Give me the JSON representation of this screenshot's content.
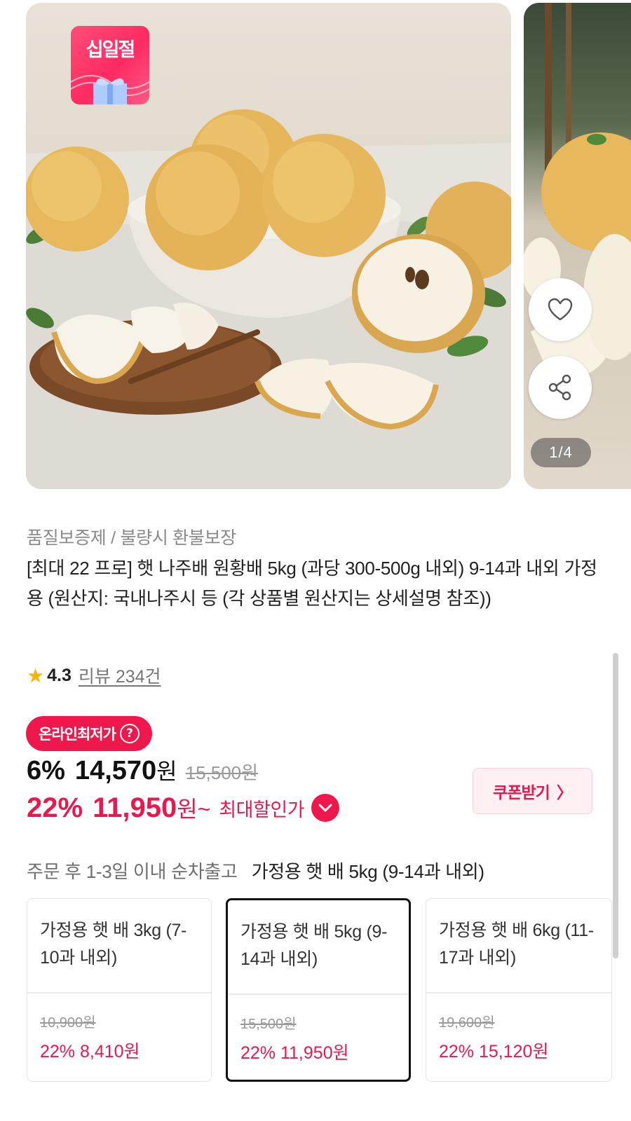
{
  "gallery": {
    "badge_text": "십일절",
    "pager": "1/4",
    "like_icon": "heart-icon",
    "share_icon": "share-icon"
  },
  "product": {
    "guarantee": "품질보증제 / 불량시 환불보장",
    "title": "[최대 22 프로] 햇 나주배 원황배 5kg (과당 300-500g 내외) 9-14과 내외 가정용 (원산지: 국내나주시 등 (각 상품별 원산지는 상세설명 참조))",
    "rating": "4.3",
    "reviews": "리뷰 234건"
  },
  "price": {
    "lowest_badge": "온라인최저가",
    "help_icon": "?",
    "discount1": "6%",
    "price1": "14,570",
    "won1": "원",
    "original": "15,500원",
    "discount2": "22%",
    "price2": "11,950",
    "won2": "원~",
    "max_label": "최대할인가",
    "coupon_button": "쿠폰받기",
    "coupon_arrow": "〉"
  },
  "shipping": {
    "text": "주문 후 1-3일 이내 순차출고",
    "selected_option": "가정용 햇 배 5kg (9-14과 내외)"
  },
  "options": [
    {
      "name": "가정용 햇 배 3kg (7-10과 내외)",
      "original": "10,900원",
      "sale": "22% 8,410원"
    },
    {
      "name": "가정용 햇 배 5kg (9-14과 내외)",
      "original": "15,500원",
      "sale": "22% 11,950원"
    },
    {
      "name": "가정용 햇 배 6kg (11-17과 내외)",
      "original": "19,600원",
      "sale": "22% 15,120원"
    }
  ],
  "colors": {
    "accent": "#e8194f",
    "badge": "#f0174c",
    "star": "#f7b500"
  }
}
